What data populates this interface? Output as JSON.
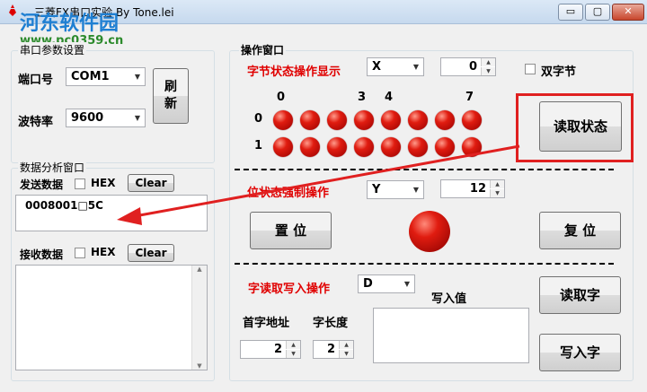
{
  "window": {
    "title": "三菱FX串口实验 By Tone.lei",
    "minimize": "▭",
    "maximize": "▢",
    "close": "✕"
  },
  "watermark": {
    "name": "河东软件园",
    "url": "www.pc0359.cn"
  },
  "serial": {
    "group_title": "串口参数设置",
    "port_label": "端口号",
    "port_value": "COM1",
    "baud_label": "波特率",
    "baud_value": "9600",
    "refresh_label": "刷\n新"
  },
  "data_analysis": {
    "group_title": "数据分析窗口",
    "send_label": "发送数据",
    "send_hex": "HEX",
    "send_clear": "Clear",
    "send_value": "0008001□5C",
    "recv_label": "接收数据",
    "recv_hex": "HEX",
    "recv_clear": "Clear",
    "recv_value": ""
  },
  "operation": {
    "group_title": "操作窗口",
    "byte_section_label": "字节状态操作显示",
    "byte_device": "X",
    "byte_index": "0",
    "double_byte_label": "双字节",
    "bit_headers": [
      "0",
      "3",
      "4",
      "7"
    ],
    "row_labels": [
      "0",
      "1"
    ],
    "read_status_label": "读取状态",
    "bit_force_label": "位状态强制操作",
    "bit_device": "Y",
    "bit_index": "12",
    "set_label": "置 位",
    "reset_label": "复 位",
    "word_section_label": "字读取写入操作",
    "word_device": "D",
    "write_value_label": "写入值",
    "first_addr_label": "首字地址",
    "first_addr_value": "2",
    "word_len_label": "字长度",
    "word_len_value": "2",
    "read_word_label": "读取字",
    "write_word_label": "写入字"
  },
  "colors": {
    "accent_red": "#e00000",
    "annotation_red": "#e02020",
    "led_red": "#e01c10"
  }
}
